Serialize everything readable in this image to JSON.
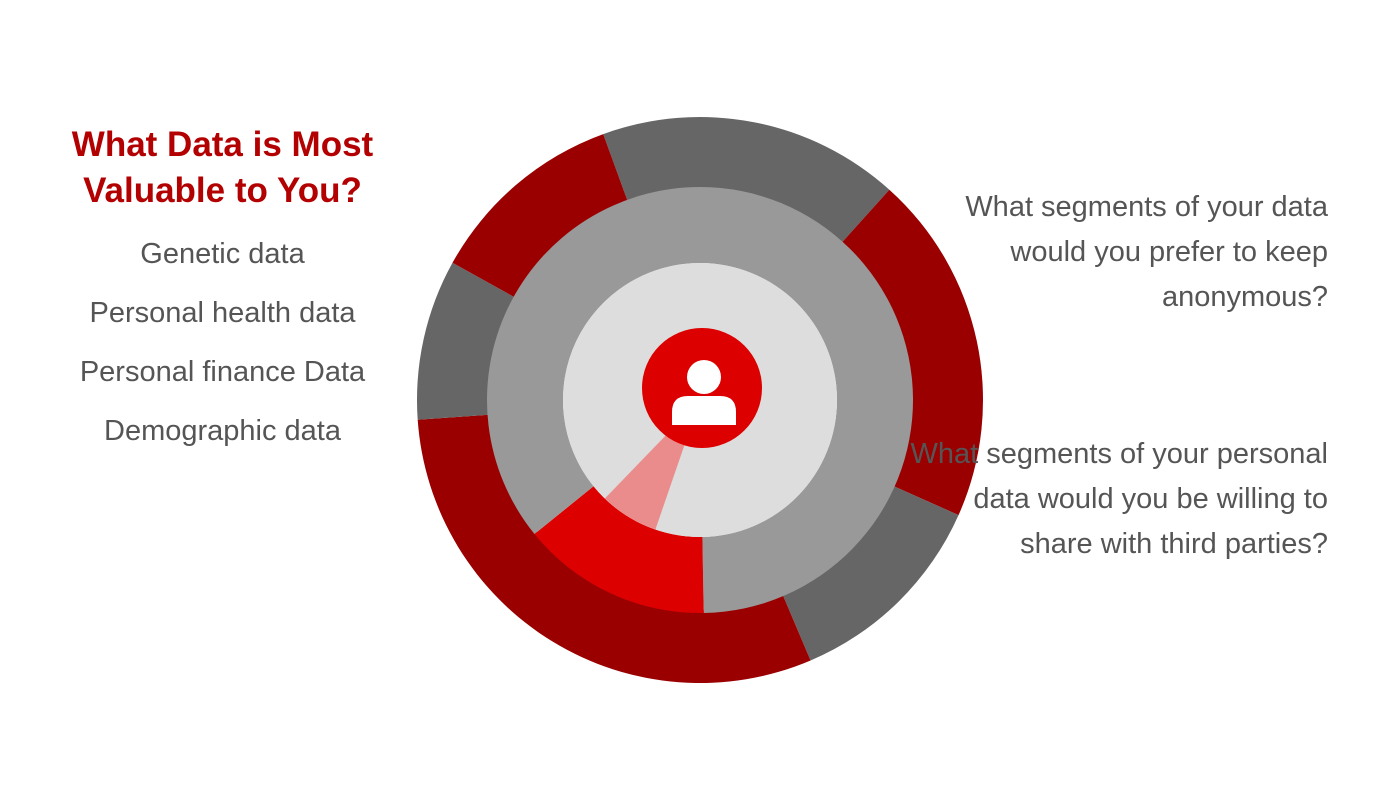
{
  "heading": "What Data is Most Valuable to You?",
  "data_types": [
    "Genetic data",
    "Personal health data",
    "Personal finance Data",
    "Demographic data"
  ],
  "questions": [
    "What segments of your data would you prefer to keep anonymous?",
    "What segments of your personal data would you be willing to share with third parties?"
  ],
  "colors": {
    "accent_red": "#b30000",
    "dark_red": "#9a0000",
    "bright_red": "#dd0000",
    "light_red": "#eb8c8c",
    "dark_gray": "#666666",
    "mid_gray": "#999999",
    "light_gray": "#dddddd",
    "text_gray": "#555555"
  },
  "center_icon": "user-icon"
}
